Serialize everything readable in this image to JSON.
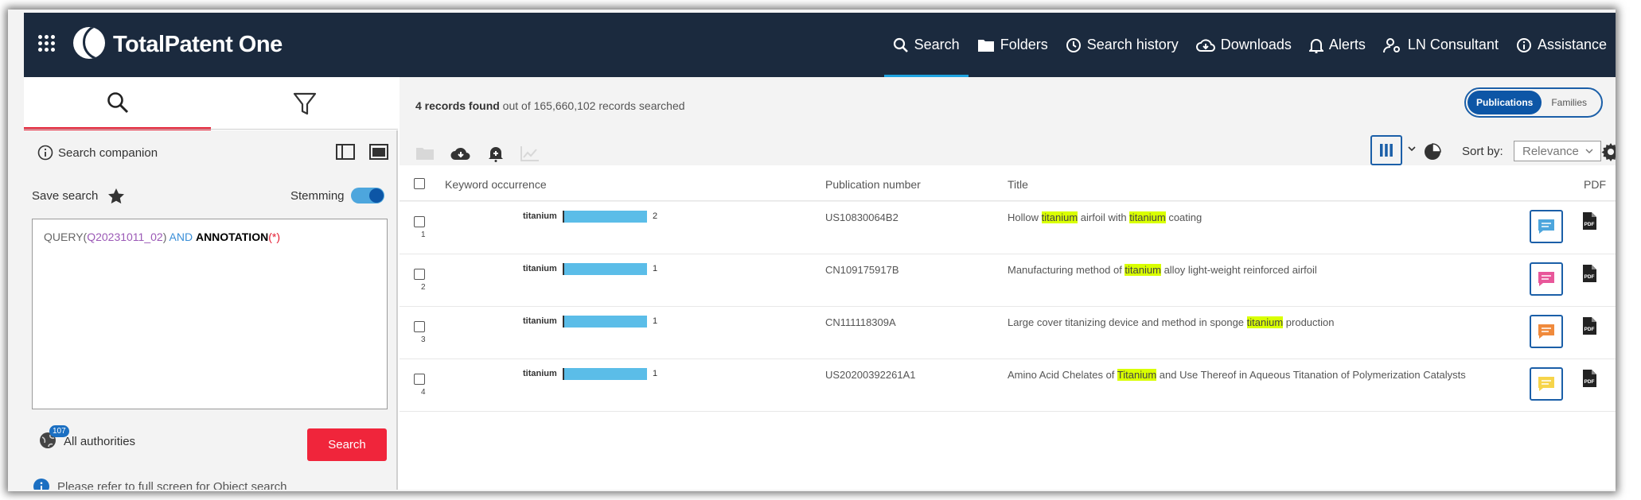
{
  "app": {
    "brand": "TotalPatent One"
  },
  "nav": {
    "items": [
      {
        "label": "Search",
        "icon": "search-icon",
        "active": true
      },
      {
        "label": "Folders",
        "icon": "folder-icon"
      },
      {
        "label": "Search history",
        "icon": "history-icon"
      },
      {
        "label": "Downloads",
        "icon": "cloud-download-icon"
      },
      {
        "label": "Alerts",
        "icon": "bell-icon"
      },
      {
        "label": "LN Consultant",
        "icon": "user-settings-icon"
      },
      {
        "label": "Assistance",
        "icon": "info-icon"
      }
    ]
  },
  "left": {
    "companion": "Search companion",
    "save_search": "Save search",
    "stemming": "Stemming",
    "stemming_on": true,
    "query": {
      "part1": "QUERY(",
      "part2": "Q20231011_02",
      "part3": ")",
      "part4": " AND ",
      "part5": "ANNOTATION",
      "part6": "(*)"
    },
    "authorities_count": "107",
    "authorities": "All authorities",
    "search_button": "Search",
    "object_note": "Please refer to full screen for Object search"
  },
  "results": {
    "found": "4 records found",
    "out_of": " out of 165,660,102 records searched",
    "view_publications": "Publications",
    "view_families": "Families",
    "sort_label": "Sort by:",
    "sort_value": "Relevance",
    "columns": {
      "keyword": "Keyword occurrence",
      "pubno": "Publication number",
      "title": "Title",
      "pdf": "PDF"
    },
    "rows": [
      {
        "num": "1",
        "keyword": "titanium",
        "count": "2",
        "pubno": "US10830064B2",
        "title": [
          {
            "t": "Hollow "
          },
          {
            "t": "titanium",
            "hl": true
          },
          {
            "t": " airfoil with "
          },
          {
            "t": "titanium",
            "hl": true
          },
          {
            "t": " coating"
          }
        ],
        "note_color": "#4da6dd"
      },
      {
        "num": "2",
        "keyword": "titanium",
        "count": "1",
        "pubno": "CN109175917B",
        "title": [
          {
            "t": "Manufacturing method of "
          },
          {
            "t": "titanium",
            "hl": true
          },
          {
            "t": " alloy light-weight reinforced airfoil"
          }
        ],
        "note_color": "#e8579a"
      },
      {
        "num": "3",
        "keyword": "titanium",
        "count": "1",
        "pubno": "CN111118309A",
        "title": [
          {
            "t": "Large cover titanizing device and method in sponge "
          },
          {
            "t": "titanium",
            "hl": true
          },
          {
            "t": " production"
          }
        ],
        "note_color": "#f08a3c"
      },
      {
        "num": "4",
        "keyword": "titanium",
        "count": "1",
        "pubno": "US20200392261A1",
        "title": [
          {
            "t": "Amino Acid Chelates of "
          },
          {
            "t": "Titanium",
            "hl": true
          },
          {
            "t": " and Use Thereof in Aqueous Titanation of Polymerization Catalysts"
          }
        ],
        "note_color": "#f6d44a"
      }
    ]
  }
}
